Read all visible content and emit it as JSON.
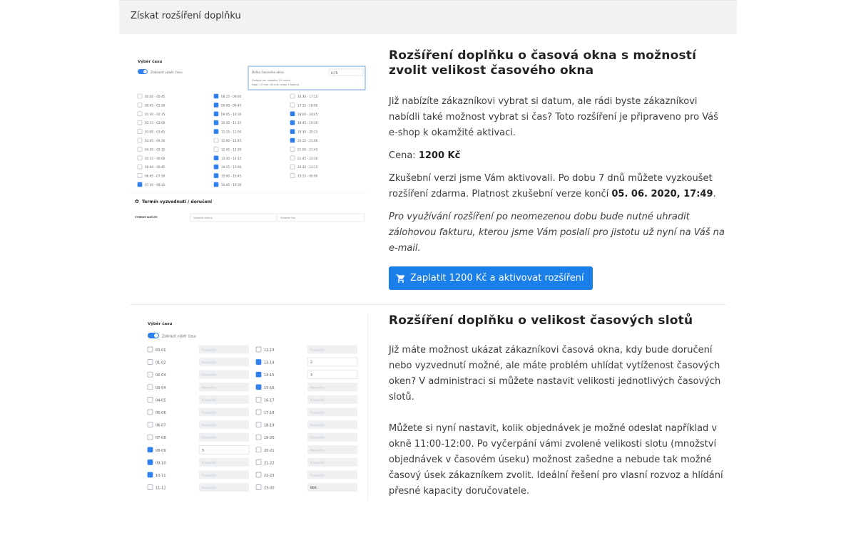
{
  "panel": {
    "header": "Získat rozšíření doplňku"
  },
  "ext1": {
    "title": "Rozšíření doplňku o časová okna s možností zvolit velikost časového okna",
    "para1": "Již nabízíte zákazníkovi vybrat si datum, ale rádi byste zákazníkovi nabídli také možnost vybrat si čas? Toto rozšíření je připraveno pro Váš e-shop k okamžité aktivaci.",
    "price_label": "Cena:",
    "price_value": "1200 Kč",
    "trial_text": "Zkušební verzi jsme Vám aktivovali. Po dobu 7 dnů můžete vyzkoušet rozšíření zdarma. Platnost zkušební verze končí",
    "trial_end": "05. 06. 2020, 17:49",
    "trial_dot": ".",
    "note": "Pro využívání rozšíření po neomezenou dobu bude nutné uhradit zálohovou fakturu, kterou jsme Vám poslali pro jistotu už nyní na Váš na e-mail.",
    "button_label": "Zaplatit 1200 Kč a aktivovat rozšíření",
    "button_icon": "cart-icon",
    "accent": "#1a7fe8",
    "shot": {
      "heading": "Výběr času",
      "toggle_label": "Zobrazit výběr času",
      "box_label": "Délka časového okna",
      "box_value": "0,75",
      "box_hint1": "Zadejte jen násobky 15 minut.",
      "box_hint2": "Např. 15 min, 30 min, nebo 1 hodina.",
      "col1": [
        "00:00 - 00:45",
        "00:45 - 01:30",
        "01:30 - 02:15",
        "02:15 - 03:00",
        "03:00 - 03:45",
        "03:45 - 04:30",
        "04:30 - 05:15",
        "05:15 - 06:00",
        "06:00 - 06:45",
        "06:45 - 07:30",
        "07:30 - 08:15"
      ],
      "col2": [
        "08:15 - 09:00",
        "09:00 - 09:45",
        "09:45 - 10:30",
        "10:30 - 11:15",
        "11:15 - 12:00",
        "12:00 - 12:45",
        "12:45 - 13:30",
        "13:30 - 14:15",
        "14:15 - 15:00",
        "15:00 - 15:45",
        "15:45 - 16:30"
      ],
      "col3": [
        "16:30 - 17:15",
        "17:15 - 18:00",
        "18:00 - 18:45",
        "18:45 - 19:30",
        "19:30 - 20:15",
        "20:15 - 21:00",
        "21:00 - 21:45",
        "21:45 - 22:30",
        "22:30 - 23:15",
        "23:15 - 00:00"
      ],
      "section": "Termín vyzvednutí / doručení",
      "date_label": "VYBRAT DATUM",
      "date_placeholder": "Vyberte datum",
      "time_placeholder": "Vyberte čas"
    }
  },
  "ext2": {
    "title": "Rozšíření doplňku o velikost časových slotů",
    "para1": "Již máte možnost ukázat zákazníkovi časová okna, kdy bude doručení nebo vyzvednutí možné, ale máte problém uhlídat vytíženost časových oken? V administraci si můžete nastavit velikosti jednotlivých časových slotů.",
    "para2": "Můžete si nyní nastavit, kolik objednávek je možné odeslat například v okně 11:00-12:00. Po vyčerpání vámi zvolené velikosti slotu (množství objednávek v časovém úseku) možnost zašedne a nebude tak možné časový úsek zákazníkem zvolit. Ideální řešení pro vlasní rozvoz a hlídání přesné kapacity doručovatele.",
    "shot": {
      "heading": "Výběr času",
      "toggle_label": "Zobrazit výběr času",
      "placeholder": "Kapacita",
      "col1": [
        "00-01",
        "01-02",
        "02-04",
        "03-04",
        "04-05",
        "05-06",
        "06-07",
        "07-08",
        "08-09",
        "09-10",
        "10-11",
        "11-12"
      ],
      "col2": [
        "12-13",
        "13-14",
        "14-15",
        "15-16",
        "16-17",
        "17-18",
        "18-19",
        "19-20",
        "20-21",
        "21-22",
        "22-23",
        "23-00"
      ],
      "val_08_09": "5",
      "val_13_14": "2",
      "val_14_15": "3",
      "val_23_00": "666"
    }
  }
}
